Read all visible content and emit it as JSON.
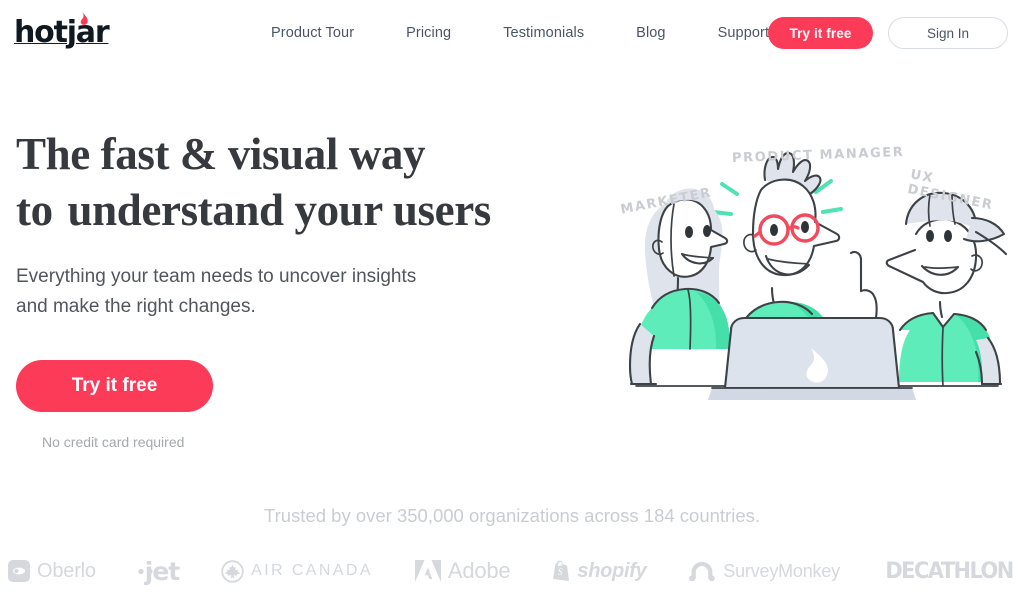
{
  "brand": {
    "logo_text": "hotjar",
    "logo_icon": "flame-icon",
    "accent_pink": "#fb3b58",
    "accent_mint": "#57edbd",
    "text_dark": "#363a3f"
  },
  "header": {
    "nav": [
      {
        "label": "Product Tour",
        "name": "nav-product-tour"
      },
      {
        "label": "Pricing",
        "name": "nav-pricing"
      },
      {
        "label": "Testimonials",
        "name": "nav-testimonials"
      },
      {
        "label": "Blog",
        "name": "nav-blog"
      },
      {
        "label": "Support",
        "name": "nav-support"
      }
    ],
    "try_free_label": "Try it free",
    "sign_in_label": "Sign In"
  },
  "hero": {
    "headline_line1": "The fast & visual way",
    "headline_line2_prefix": "to ",
    "headline_highlight": "understand your users",
    "subtext_line1": "Everything your team needs to uncover insights",
    "subtext_line2": "and make the right changes.",
    "cta_label": "Try it free",
    "cta_note": "No credit card required"
  },
  "illustration": {
    "alt": "three-coworkers-at-laptop-illustration",
    "laptop_logo_icon": "flame-icon",
    "labels": [
      {
        "text": "MARKETER",
        "name": "illustration-label-marketer"
      },
      {
        "text": "PRODUCT MANAGER",
        "name": "illustration-label-product-manager"
      },
      {
        "text": "UX DESIGNER",
        "name": "illustration-label-ux-designer"
      }
    ]
  },
  "social_proof": {
    "headline": "Trusted by over 350,000 organizations across 184 countries.",
    "logos": [
      {
        "name": "logo-oberlo",
        "label": "Oberlo",
        "icon": "oberlo-square-icon"
      },
      {
        "name": "logo-jet",
        "label": "jet",
        "icon": "jet-dots-icon"
      },
      {
        "name": "logo-air-canada",
        "label": "AIR CANADA",
        "icon": "maple-leaf-circle-icon"
      },
      {
        "name": "logo-adobe",
        "label": "Adobe",
        "icon": "adobe-a-icon"
      },
      {
        "name": "logo-shopify",
        "label": "shopify",
        "icon": "shopify-bag-icon"
      },
      {
        "name": "logo-surveymonkey",
        "label": "SurveyMonkey",
        "icon": "surveymonkey-arch-icon"
      },
      {
        "name": "logo-decathlon",
        "label": "DECATHLON",
        "icon": "none"
      }
    ]
  }
}
